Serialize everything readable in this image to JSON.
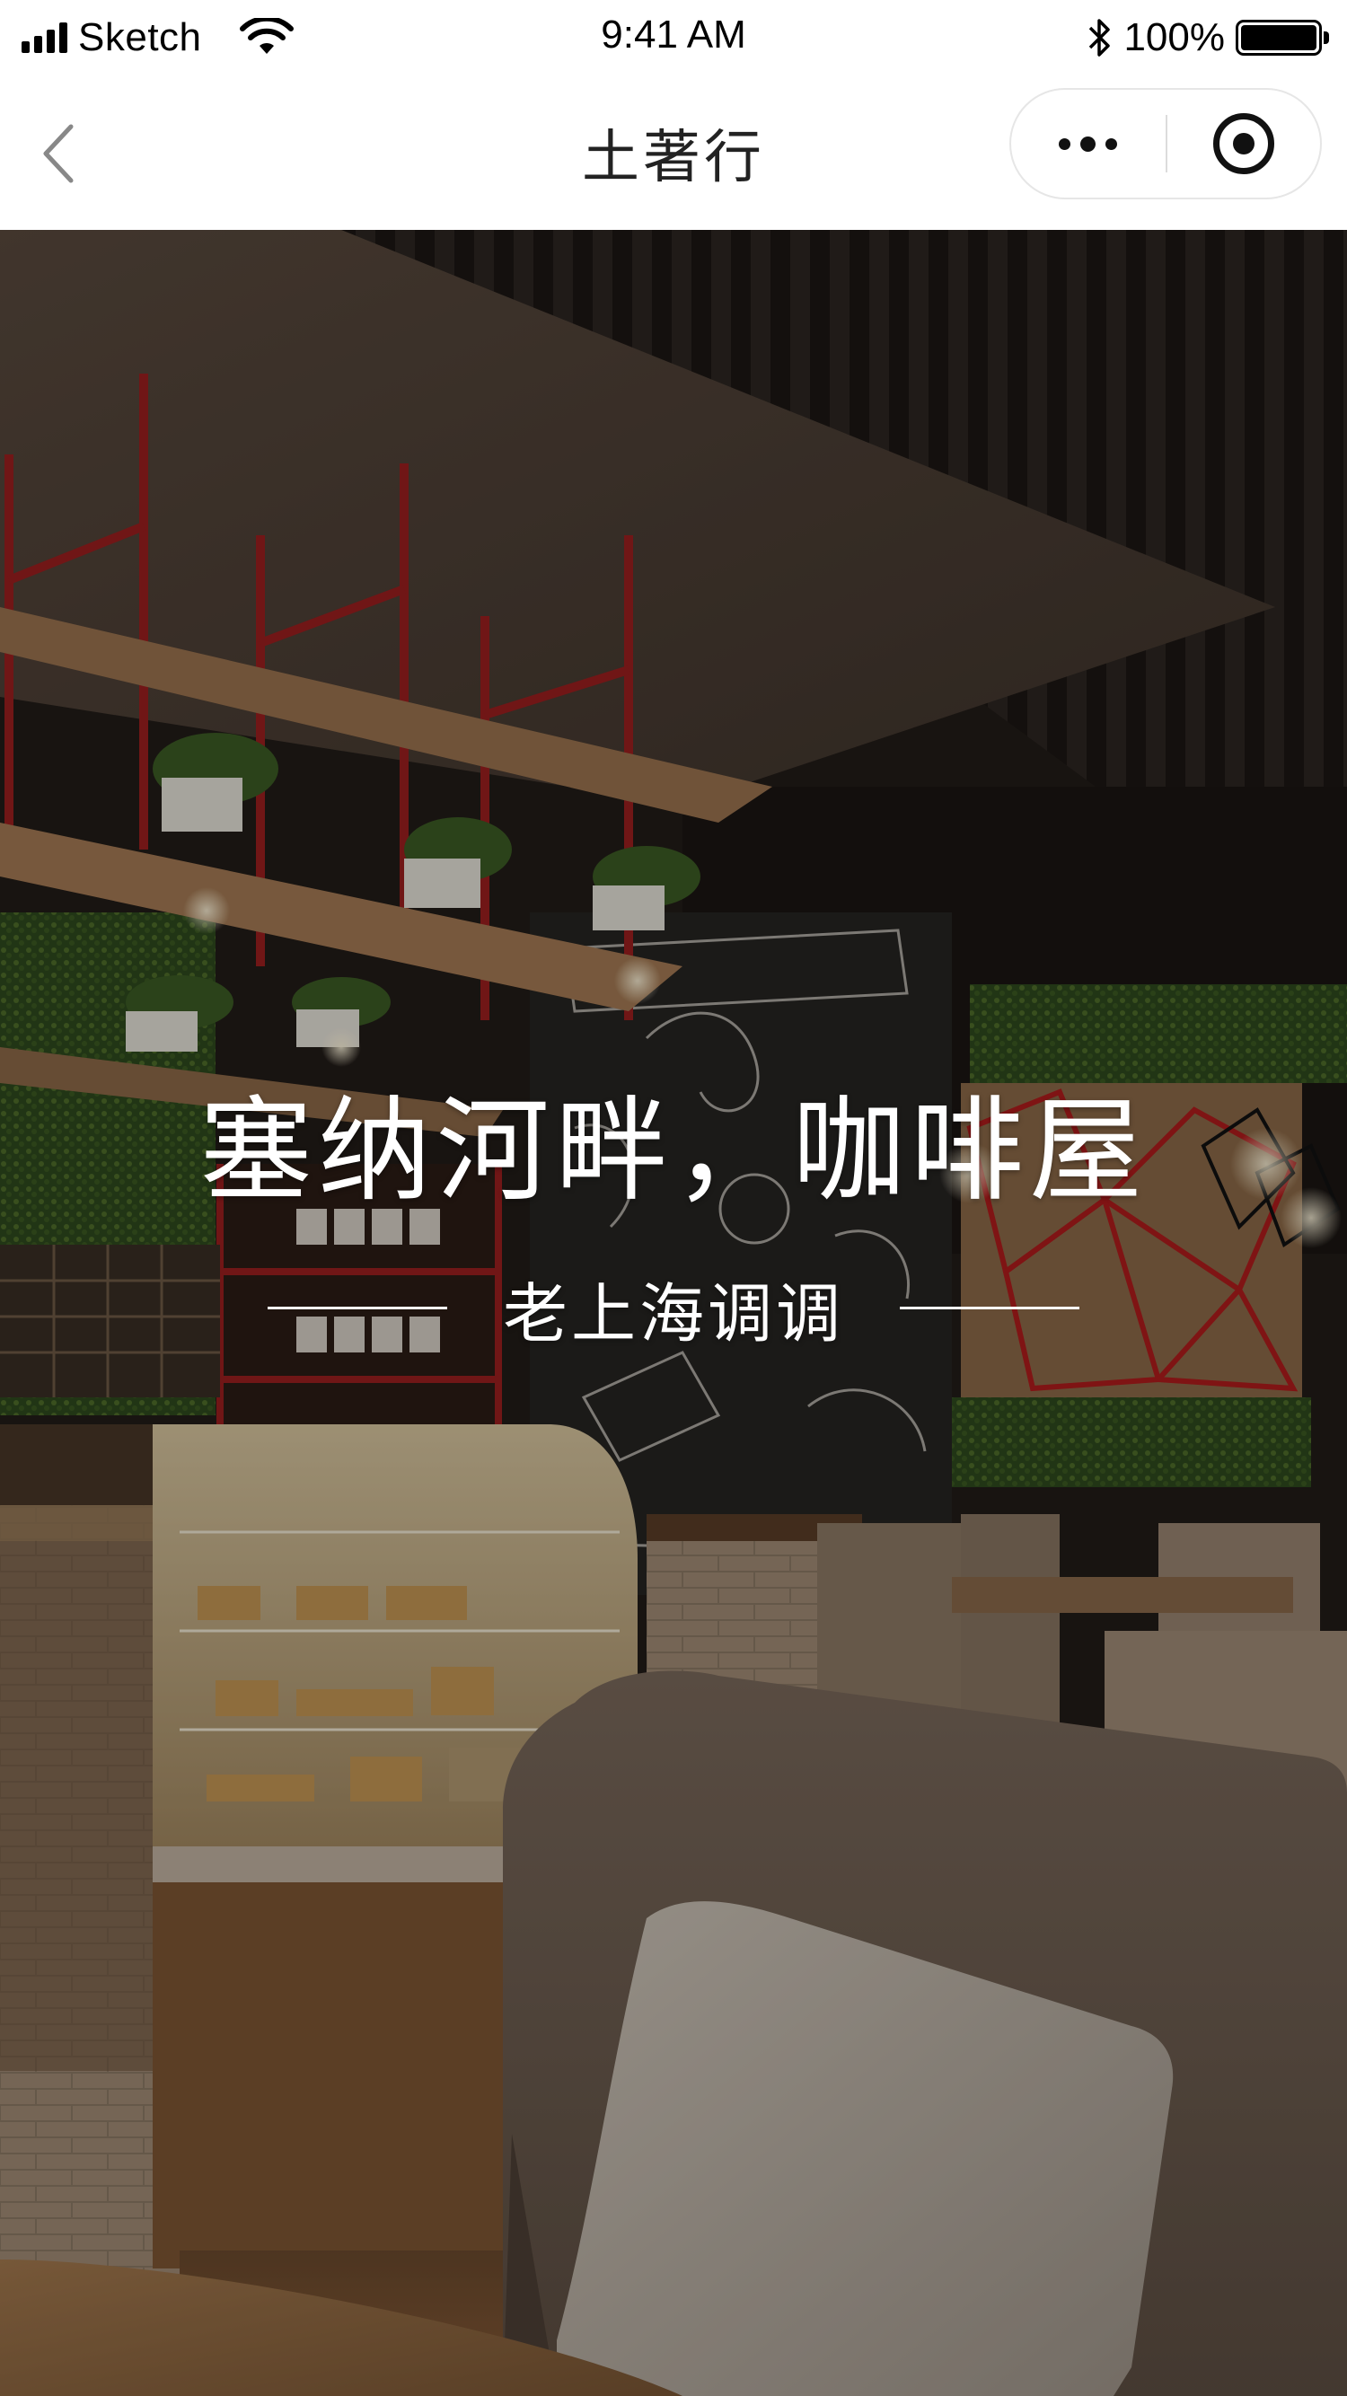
{
  "status_bar": {
    "carrier": "Sketch",
    "time": "9:41 AM",
    "battery_percent": "100%"
  },
  "nav_bar": {
    "title": "土著行",
    "back_icon": "chevron-left-icon",
    "more_icon": "more-dots-icon",
    "close_icon": "target-circle-icon"
  },
  "hero": {
    "title": "塞纳河畔，咖啡屋",
    "subtitle": "老上海调调",
    "image_description_icon": "cafe-interior-photo"
  },
  "colors": {
    "nav_background": "#ffffff",
    "title_text": "#222222",
    "hero_text": "#ffffff"
  }
}
